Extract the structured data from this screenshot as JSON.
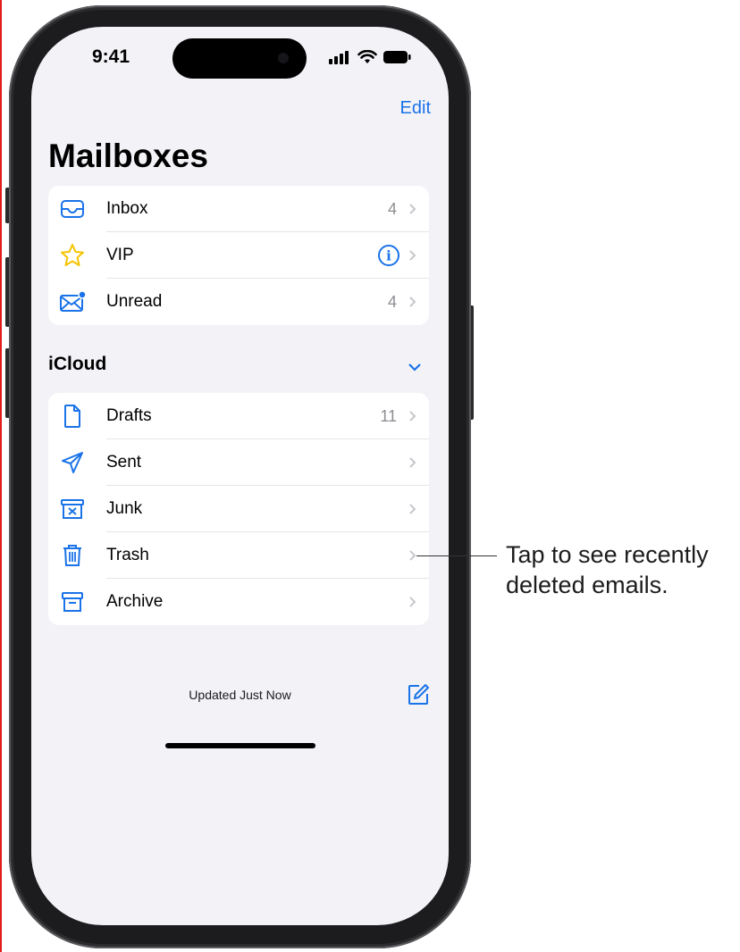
{
  "status_bar": {
    "time": "9:41"
  },
  "nav": {
    "edit_label": "Edit",
    "title": "Mailboxes"
  },
  "favorites": [
    {
      "label": "Inbox",
      "count": "4",
      "icon": "tray-icon"
    },
    {
      "label": "VIP",
      "count": "",
      "icon": "star-icon",
      "badge": "info-icon"
    },
    {
      "label": "Unread",
      "count": "4",
      "icon": "unread-envelope-icon"
    }
  ],
  "icloud": {
    "header": "iCloud",
    "items": [
      {
        "label": "Drafts",
        "count": "11",
        "icon": "document-icon"
      },
      {
        "label": "Sent",
        "count": "",
        "icon": "paperplane-icon"
      },
      {
        "label": "Junk",
        "count": "",
        "icon": "junk-bin-icon"
      },
      {
        "label": "Trash",
        "count": "",
        "icon": "trash-icon"
      },
      {
        "label": "Archive",
        "count": "",
        "icon": "archive-box-icon"
      }
    ]
  },
  "toolbar": {
    "status": "Updated Just Now",
    "compose_icon": "compose-icon"
  },
  "callout": {
    "line1": "Tap to see recently",
    "line2": "deleted emails."
  },
  "colors": {
    "accent": "#1a73e8",
    "background": "#f2f2f7",
    "vip_star": "#f5c400"
  }
}
